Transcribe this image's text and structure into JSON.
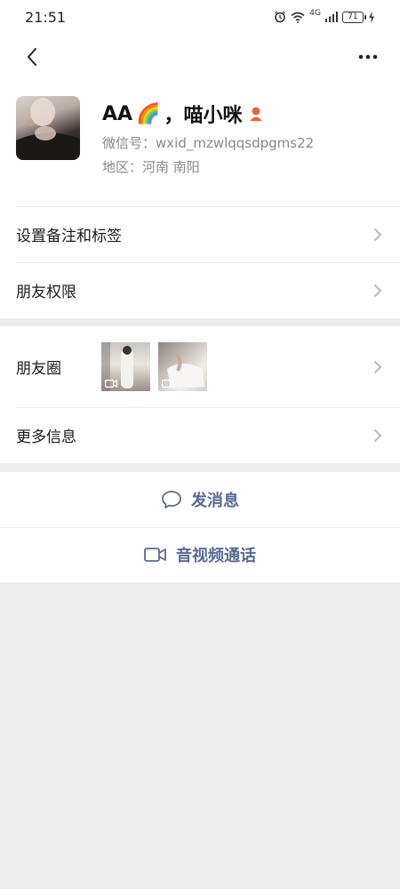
{
  "status": {
    "time": "21:51",
    "network": "4G",
    "battery": "71"
  },
  "profile": {
    "name_prefix": "AA",
    "name_emoji": "🌈",
    "name_suffix": "，喵小咪",
    "wechat_id": "微信号：wxid_mzwlqqsdpgms22",
    "region": "地区：河南  南阳"
  },
  "menu": {
    "remark": "设置备注和标签",
    "permissions": "朋友权限",
    "moments": "朋友圈",
    "more_info": "更多信息"
  },
  "actions": {
    "message": "发消息",
    "call": "音视频通话"
  },
  "colors": {
    "link": "#576b95",
    "gender": "#e8643c"
  }
}
